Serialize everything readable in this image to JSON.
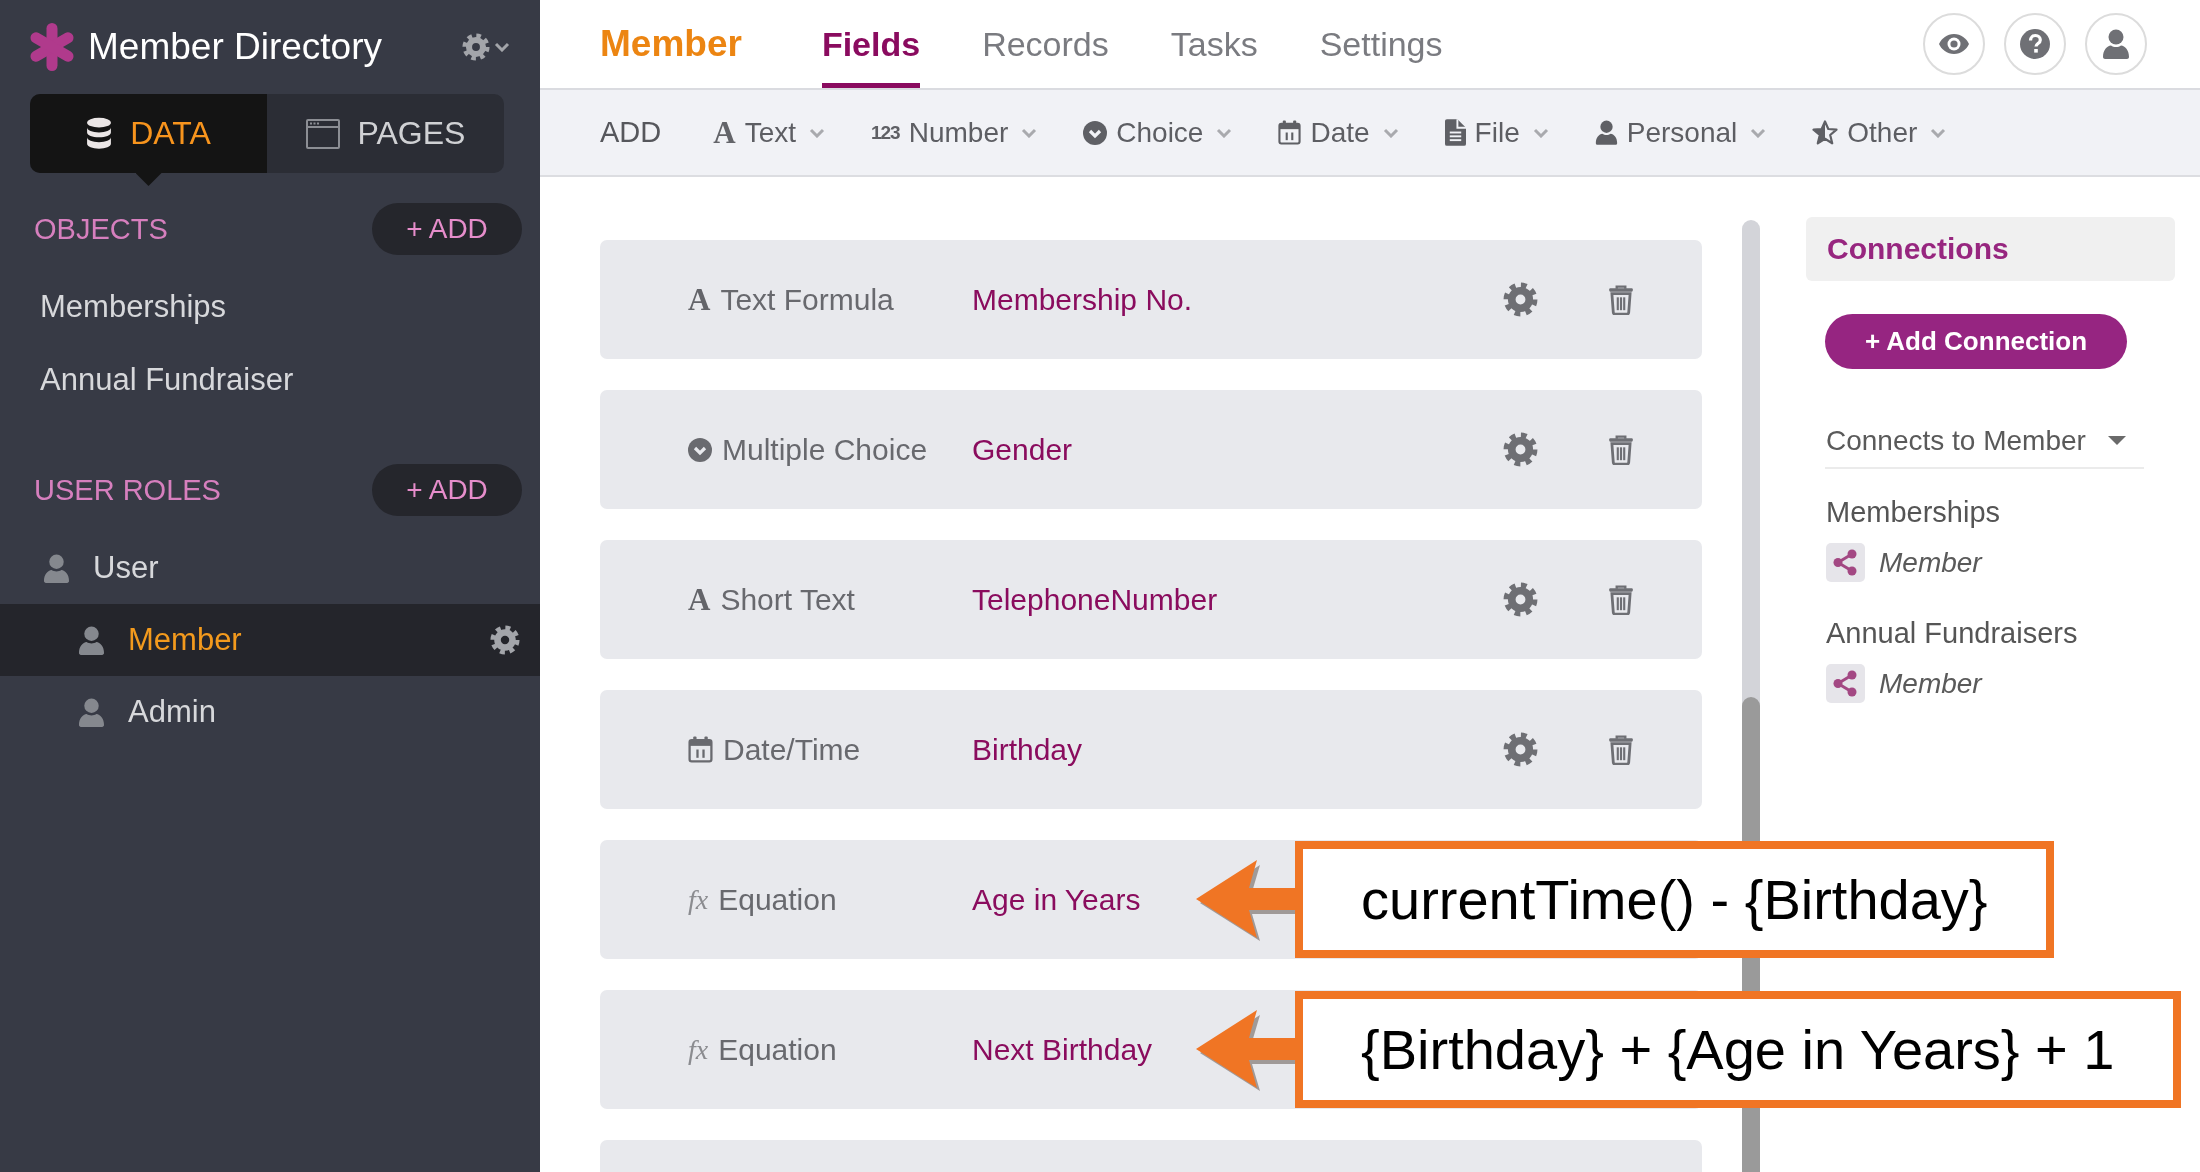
{
  "sidebar": {
    "app_title": "Member Directory",
    "tabs": [
      {
        "label": "DATA",
        "kind": "data",
        "selected": true
      },
      {
        "label": "PAGES",
        "kind": "pages",
        "selected": false
      }
    ],
    "objects": {
      "heading": "OBJECTS",
      "add_label": "+ ADD",
      "items": [
        {
          "label": "Memberships",
          "selected": false
        },
        {
          "label": "Annual Fundraiser",
          "selected": false
        }
      ]
    },
    "user_roles": {
      "heading": "USER ROLES",
      "add_label": "+ ADD",
      "items": [
        {
          "label": "User",
          "selected": false,
          "children": [
            {
              "label": "Member",
              "selected": true
            },
            {
              "label": "Admin",
              "selected": false
            }
          ]
        }
      ]
    }
  },
  "header": {
    "object_name": "Member",
    "tabs": [
      {
        "label": "Fields",
        "selected": true
      },
      {
        "label": "Records",
        "selected": false
      },
      {
        "label": "Tasks",
        "selected": false
      },
      {
        "label": "Settings",
        "selected": false
      }
    ]
  },
  "toolbar": {
    "add_label": "ADD",
    "items": [
      {
        "label": "Text",
        "kind": "text",
        "icon": "A"
      },
      {
        "label": "Number",
        "kind": "number",
        "icon": "123"
      },
      {
        "label": "Choice",
        "kind": "choice"
      },
      {
        "label": "Date",
        "kind": "date"
      },
      {
        "label": "File",
        "kind": "file"
      },
      {
        "label": "Personal",
        "kind": "personal"
      },
      {
        "label": "Other",
        "kind": "other"
      }
    ]
  },
  "fields": [
    {
      "kind": "text",
      "icon": "A",
      "type": "Text Formula",
      "name": "Membership No."
    },
    {
      "kind": "choice",
      "type": "Multiple Choice",
      "name": "Gender"
    },
    {
      "kind": "text",
      "icon": "A",
      "type": "Short Text",
      "name": "TelephoneNumber"
    },
    {
      "kind": "date",
      "type": "Date/Time",
      "name": "Birthday"
    },
    {
      "kind": "equation",
      "icon": "fx",
      "type": "Equation",
      "name": "Age in Years",
      "annotation": "currentTime() - {Birthday}"
    },
    {
      "kind": "equation",
      "icon": "fx",
      "type": "Equation",
      "name": "Next Birthday",
      "annotation": "{Birthday} + {Age in Years} + 1"
    }
  ],
  "connections": {
    "title": "Connections",
    "add_button": "+ Add Connection",
    "filter": "Connects to Member",
    "groups": [
      {
        "title": "Memberships",
        "items": [
          "Member"
        ]
      },
      {
        "title": "Annual Fundraisers",
        "items": [
          "Member"
        ]
      }
    ]
  }
}
